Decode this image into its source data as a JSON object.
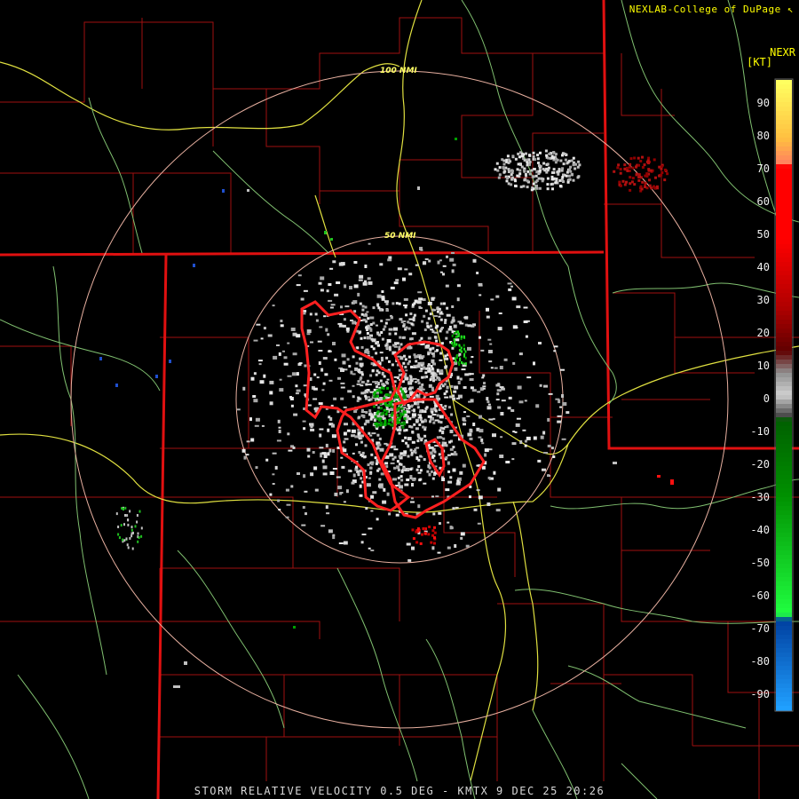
{
  "header": {
    "credit": "NEXLAB-College of DuPage",
    "credit_icon": "arrow-corner-icon",
    "product": "NEXR",
    "unit": "[KT]"
  },
  "footer": {
    "caption": "STORM RELATIVE VELOCITY 0.5 DEG - KMTX 9 DEC 25 20:26"
  },
  "range_rings": [
    {
      "label": "50 NMI"
    },
    {
      "label": "100 NMI"
    }
  ],
  "legend": {
    "ticks": [
      "90",
      "80",
      "70",
      "60",
      "50",
      "40",
      "30",
      "20",
      "10",
      "0",
      "-10",
      "-20",
      "-30",
      "-40",
      "-50",
      "-60",
      "-70",
      "-80",
      "-90"
    ]
  },
  "colors": {
    "background": "#000000",
    "state_border": "#e01010",
    "county_border": "#a01010",
    "highway": "#e0e040",
    "road": "#80c070",
    "range_ring": "#e8b0a0",
    "warning_polygon": "#ff2020",
    "text": "#ffff00"
  }
}
